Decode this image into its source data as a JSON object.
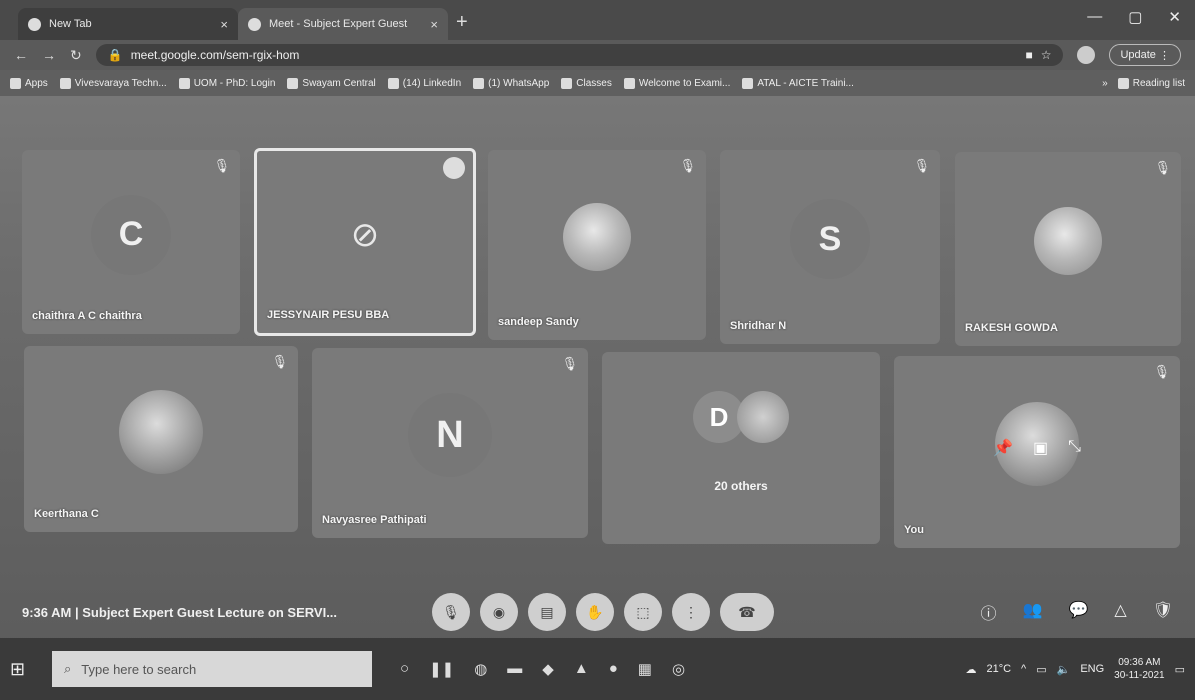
{
  "tabs": [
    {
      "title": "New Tab",
      "close": "×"
    },
    {
      "title": "Meet - Subject Expert Guest",
      "close": "×"
    }
  ],
  "new_tab_glyph": "+",
  "window_controls": {
    "minimize": "—",
    "maximize": "▢",
    "close": "✕"
  },
  "address": {
    "url": "meet.google.com/sem-rgix-hom",
    "update_label": "Update"
  },
  "bookmarks": [
    "Apps",
    "Vivesvaraya Techn...",
    "UOM - PhD: Login",
    "Swayam Central",
    "(14) LinkedIn",
    "(1) WhatsApp",
    "Classes",
    "Welcome to Exami...",
    "ATAL - AICTE Traini..."
  ],
  "reading_list": "Reading list",
  "participants": [
    {
      "name": "chaithra A C chaithra",
      "avatar": "C",
      "kind": "letter"
    },
    {
      "name": "JESSYNAIR PESU BBA",
      "avatar": "camera-off-icon",
      "kind": "camoff"
    },
    {
      "name": "sandeep Sandy",
      "avatar": "",
      "kind": "photo"
    },
    {
      "name": "Shridhar N",
      "avatar": "S",
      "kind": "letter"
    },
    {
      "name": "RAKESH GOWDA",
      "avatar": "",
      "kind": "photo"
    },
    {
      "name": "Keerthana C",
      "avatar": "",
      "kind": "photo"
    },
    {
      "name": "Navyasree Pathipati",
      "avatar": "N",
      "kind": "letter"
    },
    {
      "name": "20 others",
      "avatar": "D",
      "kind": "group"
    },
    {
      "name": "You",
      "avatar": "",
      "kind": "self"
    }
  ],
  "meeting": {
    "time": "9:36 AM",
    "separator": "|",
    "title": "Subject Expert Guest Lecture on SERVI..."
  },
  "taskbar": {
    "search_placeholder": "Type here to search",
    "weather": "21°C",
    "lang": "ENG",
    "clock_time": "09:36 AM",
    "clock_date": "30-11-2021"
  }
}
